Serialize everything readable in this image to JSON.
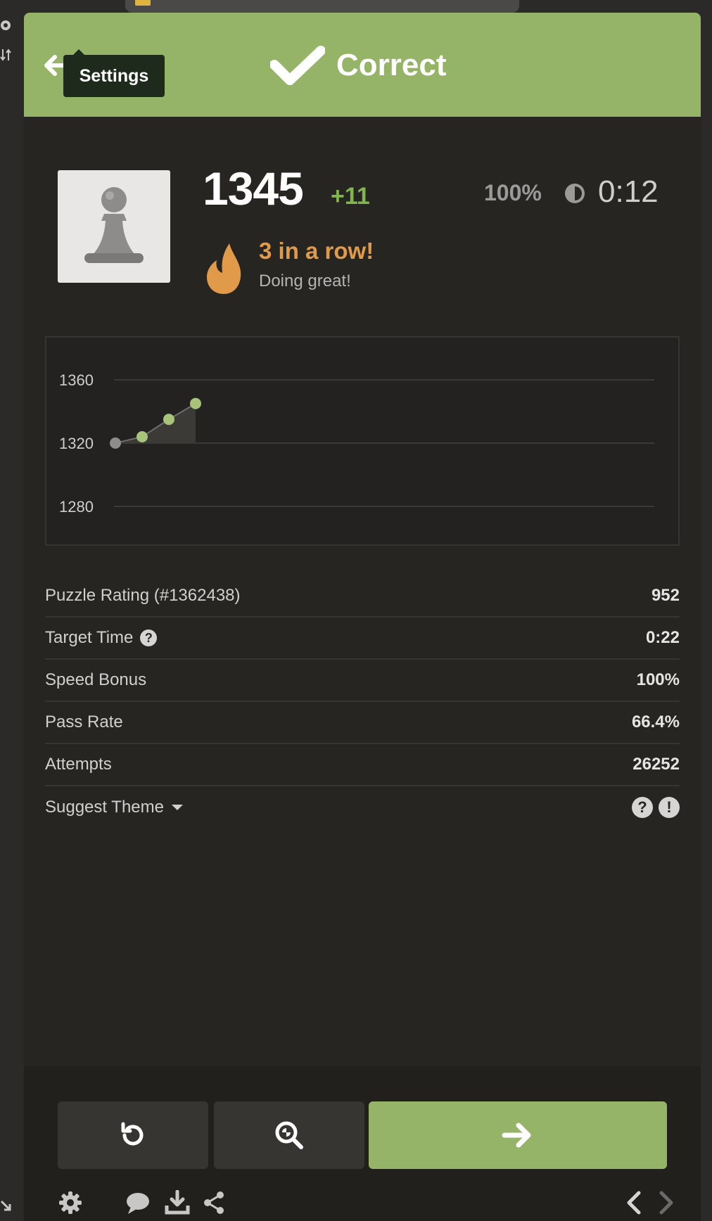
{
  "header": {
    "title": "Correct",
    "tooltip": "Settings",
    "color": "#95b467"
  },
  "rating": {
    "value": "1345",
    "delta": "+11",
    "accuracy": "100%",
    "timer": "0:12"
  },
  "streak": {
    "title": "3 in a row!",
    "subtitle": "Doing great!"
  },
  "chart_data": {
    "type": "line",
    "y_ticks": [
      "1360",
      "1320",
      "1280"
    ],
    "ylim": [
      1280,
      1360
    ],
    "x": [
      1,
      2,
      3,
      4
    ],
    "values": [
      1320,
      1324,
      1335,
      1345
    ]
  },
  "stats": [
    {
      "label": "Puzzle Rating (#1362438)",
      "value": "952"
    },
    {
      "label": "Target Time",
      "value": "0:22"
    },
    {
      "label": "Speed Bonus",
      "value": "100%"
    },
    {
      "label": "Pass Rate",
      "value": "66.4%"
    },
    {
      "label": "Attempts",
      "value": "26252"
    }
  ],
  "suggest_theme": {
    "label": "Suggest Theme"
  },
  "icons": {
    "help": "?",
    "report": "!"
  }
}
